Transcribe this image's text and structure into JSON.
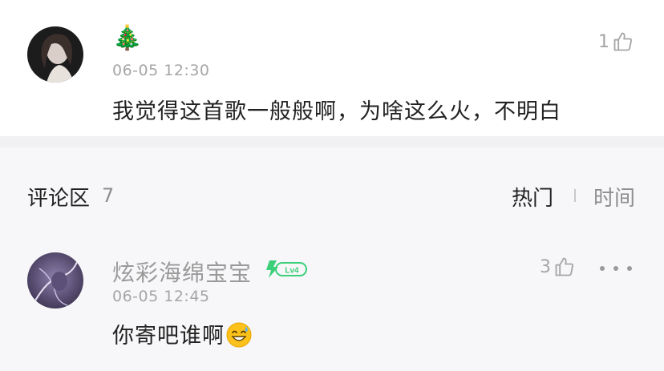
{
  "comment1": {
    "name_emoji": "🎄",
    "timestamp": "06-05 12:30",
    "content": "我觉得这首歌一般般啊，为啥这么火，不明白",
    "like_count": "1"
  },
  "section": {
    "title": "评论区",
    "count": "7",
    "sort_hot": "热门",
    "sort_time": "时间"
  },
  "comment2": {
    "username": "炫彩海绵宝宝",
    "level": "Lv4",
    "timestamp": "06-05 12:45",
    "content": "你寄吧谁啊",
    "like_count": "3"
  },
  "colors": {
    "level_badge": "#3ccf7a",
    "muted": "#a6a6a6",
    "text": "#222222"
  }
}
